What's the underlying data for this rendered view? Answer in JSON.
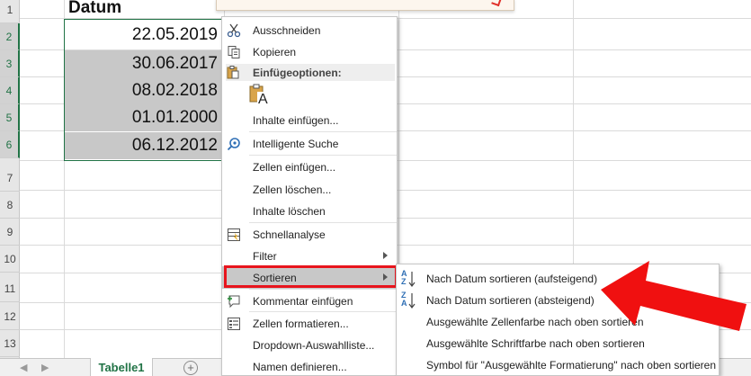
{
  "sheet": {
    "row_numbers": [
      "1",
      "2",
      "3",
      "4",
      "5",
      "6",
      "7",
      "8",
      "9",
      "10",
      "11",
      "12",
      "13"
    ],
    "header": "Datum",
    "values": [
      "22.05.2019",
      "30.06.2017",
      "08.02.2018",
      "01.01.2000",
      "06.12.2012"
    ]
  },
  "tabs": {
    "nav_prev": "◀",
    "nav_next": "▶",
    "active_tab": "Tabelle1",
    "add_label": "+"
  },
  "context_menu": {
    "cut": "Ausschneiden",
    "copy": "Kopieren",
    "paste_options_header": "Einfügeoptionen:",
    "paste_option_glyph": "A",
    "paste_special": "Inhalte einfügen...",
    "smart_lookup": "Intelligente Suche",
    "insert_cells": "Zellen einfügen...",
    "delete_cells": "Zellen löschen...",
    "clear_contents": "Inhalte löschen",
    "quick_analysis": "Schnellanalyse",
    "filter": "Filter",
    "sort": "Sortieren",
    "insert_comment": "Kommentar einfügen",
    "format_cells": "Zellen formatieren...",
    "dropdown_list": "Dropdown-Auswahlliste...",
    "define_name": "Namen definieren..."
  },
  "sort_submenu": {
    "ascending": "Nach Datum sortieren (aufsteigend)",
    "descending": "Nach Datum sortieren (absteigend)",
    "cell_color_top": "Ausgewählte Zellenfarbe nach oben sortieren",
    "font_color_top": "Ausgewählte Schriftfarbe nach oben sortieren",
    "format_icon_top": "Symbol für \"Ausgewählte Formatierung\" nach oben sortieren",
    "asc_icon_top": "A",
    "asc_icon_bottom": "Z",
    "desc_icon_top": "Z",
    "desc_icon_bottom": "A"
  },
  "colors": {
    "excel_green": "#217346",
    "highlight_red": "#e8141d",
    "selection_gray": "#c8c8c8"
  },
  "icons": {
    "cut": "scissors-icon",
    "copy": "copy-icon",
    "paste": "clipboard-icon",
    "smart_lookup": "search-icon",
    "quick_analysis": "quick-analysis-icon",
    "comment": "comment-icon",
    "format_cells": "format-cells-icon",
    "sort_asc": "sort-ascending-icon",
    "sort_desc": "sort-descending-icon",
    "annotation": "red-arrow-icon"
  }
}
